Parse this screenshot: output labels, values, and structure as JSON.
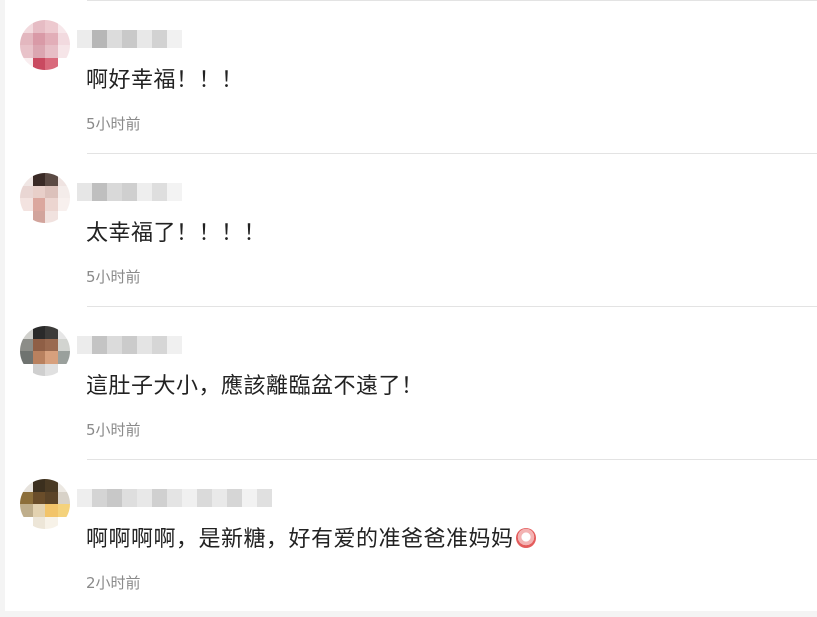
{
  "comments": [
    {
      "text": "啊好幸福！！！",
      "time": "5小时前"
    },
    {
      "text": "太幸福了！！！！",
      "time": "5小时前"
    },
    {
      "text": "這肚子大小，應該離臨盆不遠了！",
      "time": "5小时前"
    },
    {
      "text": "啊啊啊啊，是新糖，好有爱的准爸爸准妈妈",
      "time": "2小时前",
      "trailing_icon": "flower-emoji-icon"
    }
  ]
}
